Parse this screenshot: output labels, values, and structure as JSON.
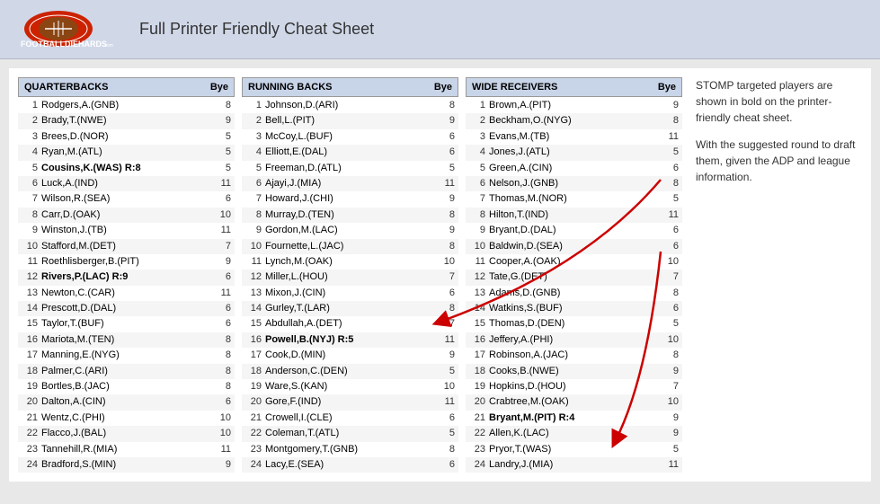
{
  "header": {
    "title": "Full Printer Friendly Cheat Sheet"
  },
  "sidebar": {
    "text1": "STOMP targeted players are shown in bold on the printer-friendly cheat sheet.",
    "text2": "With the suggested round to draft them, given the ADP and league information."
  },
  "columns": {
    "quarterbacks": {
      "header": "QUARTERBACKS",
      "bye_label": "Bye",
      "players": [
        {
          "num": 1,
          "name": "Rodgers,A.(GNB)",
          "bye": 8,
          "bold": false
        },
        {
          "num": 2,
          "name": "Brady,T.(NWE)",
          "bye": 9,
          "bold": false
        },
        {
          "num": 3,
          "name": "Brees,D.(NOR)",
          "bye": 5,
          "bold": false
        },
        {
          "num": 4,
          "name": "Ryan,M.(ATL)",
          "bye": 5,
          "bold": false
        },
        {
          "num": 5,
          "name": "Cousins,K.(WAS) R:8",
          "bye": 5,
          "bold": true
        },
        {
          "num": 6,
          "name": "Luck,A.(IND)",
          "bye": 11,
          "bold": false
        },
        {
          "num": 7,
          "name": "Wilson,R.(SEA)",
          "bye": 6,
          "bold": false
        },
        {
          "num": 8,
          "name": "Carr,D.(OAK)",
          "bye": 10,
          "bold": false
        },
        {
          "num": 9,
          "name": "Winston,J.(TB)",
          "bye": 11,
          "bold": false
        },
        {
          "num": 10,
          "name": "Stafford,M.(DET)",
          "bye": 7,
          "bold": false
        },
        {
          "num": 11,
          "name": "Roethlisberger,B.(PIT)",
          "bye": 9,
          "bold": false
        },
        {
          "num": 12,
          "name": "Rivers,P.(LAC) R:9",
          "bye": 6,
          "bold": true
        },
        {
          "num": 13,
          "name": "Newton,C.(CAR)",
          "bye": 11,
          "bold": false
        },
        {
          "num": 14,
          "name": "Prescott,D.(DAL)",
          "bye": 6,
          "bold": false
        },
        {
          "num": 15,
          "name": "Taylor,T.(BUF)",
          "bye": 6,
          "bold": false
        },
        {
          "num": 16,
          "name": "Mariota,M.(TEN)",
          "bye": 8,
          "bold": false
        },
        {
          "num": 17,
          "name": "Manning,E.(NYG)",
          "bye": 8,
          "bold": false
        },
        {
          "num": 18,
          "name": "Palmer,C.(ARI)",
          "bye": 8,
          "bold": false
        },
        {
          "num": 19,
          "name": "Bortles,B.(JAC)",
          "bye": 8,
          "bold": false
        },
        {
          "num": 20,
          "name": "Dalton,A.(CIN)",
          "bye": 6,
          "bold": false
        },
        {
          "num": 21,
          "name": "Wentz,C.(PHI)",
          "bye": 10,
          "bold": false
        },
        {
          "num": 22,
          "name": "Flacco,J.(BAL)",
          "bye": 10,
          "bold": false
        },
        {
          "num": 23,
          "name": "Tannehill,R.(MIA)",
          "bye": 11,
          "bold": false
        },
        {
          "num": 24,
          "name": "Bradford,S.(MIN)",
          "bye": 9,
          "bold": false
        }
      ]
    },
    "runningbacks": {
      "header": "RUNNING BACKS",
      "bye_label": "Bye",
      "players": [
        {
          "num": 1,
          "name": "Johnson,D.(ARI)",
          "bye": 8,
          "bold": false
        },
        {
          "num": 2,
          "name": "Bell,L.(PIT)",
          "bye": 9,
          "bold": false
        },
        {
          "num": 3,
          "name": "McCoy,L.(BUF)",
          "bye": 6,
          "bold": false
        },
        {
          "num": 4,
          "name": "Elliott,E.(DAL)",
          "bye": 6,
          "bold": false
        },
        {
          "num": 5,
          "name": "Freeman,D.(ATL)",
          "bye": 5,
          "bold": false
        },
        {
          "num": 6,
          "name": "Ajayi,J.(MIA)",
          "bye": 11,
          "bold": false
        },
        {
          "num": 7,
          "name": "Howard,J.(CHI)",
          "bye": 9,
          "bold": false
        },
        {
          "num": 8,
          "name": "Murray,D.(TEN)",
          "bye": 8,
          "bold": false
        },
        {
          "num": 9,
          "name": "Gordon,M.(LAC)",
          "bye": 9,
          "bold": false
        },
        {
          "num": 10,
          "name": "Fournette,L.(JAC)",
          "bye": 8,
          "bold": false
        },
        {
          "num": 11,
          "name": "Lynch,M.(OAK)",
          "bye": 10,
          "bold": false
        },
        {
          "num": 12,
          "name": "Miller,L.(HOU)",
          "bye": 7,
          "bold": false
        },
        {
          "num": 13,
          "name": "Mixon,J.(CIN)",
          "bye": 6,
          "bold": false
        },
        {
          "num": 14,
          "name": "Gurley,T.(LAR)",
          "bye": 8,
          "bold": false
        },
        {
          "num": 15,
          "name": "Abdullah,A.(DET)",
          "bye": 7,
          "bold": false
        },
        {
          "num": 16,
          "name": "Powell,B.(NYJ) R:5",
          "bye": 11,
          "bold": true
        },
        {
          "num": 17,
          "name": "Cook,D.(MIN)",
          "bye": 9,
          "bold": false
        },
        {
          "num": 18,
          "name": "Anderson,C.(DEN)",
          "bye": 5,
          "bold": false
        },
        {
          "num": 19,
          "name": "Ware,S.(KAN)",
          "bye": 10,
          "bold": false
        },
        {
          "num": 20,
          "name": "Gore,F.(IND)",
          "bye": 11,
          "bold": false
        },
        {
          "num": 21,
          "name": "Crowell,I.(CLE)",
          "bye": 6,
          "bold": false
        },
        {
          "num": 22,
          "name": "Coleman,T.(ATL)",
          "bye": 5,
          "bold": false
        },
        {
          "num": 23,
          "name": "Montgomery,T.(GNB)",
          "bye": 8,
          "bold": false
        },
        {
          "num": 24,
          "name": "Lacy,E.(SEA)",
          "bye": 6,
          "bold": false
        }
      ]
    },
    "widereceivers": {
      "header": "WIDE RECEIVERS",
      "bye_label": "Bye",
      "players": [
        {
          "num": 1,
          "name": "Brown,A.(PIT)",
          "bye": 9,
          "bold": false
        },
        {
          "num": 2,
          "name": "Beckham,O.(NYG)",
          "bye": 8,
          "bold": false
        },
        {
          "num": 3,
          "name": "Evans,M.(TB)",
          "bye": 11,
          "bold": false
        },
        {
          "num": 4,
          "name": "Jones,J.(ATL)",
          "bye": 5,
          "bold": false
        },
        {
          "num": 5,
          "name": "Green,A.(CIN)",
          "bye": 6,
          "bold": false
        },
        {
          "num": 6,
          "name": "Nelson,J.(GNB)",
          "bye": 8,
          "bold": false
        },
        {
          "num": 7,
          "name": "Thomas,M.(NOR)",
          "bye": 5,
          "bold": false
        },
        {
          "num": 8,
          "name": "Hilton,T.(IND)",
          "bye": 11,
          "bold": false
        },
        {
          "num": 9,
          "name": "Bryant,D.(DAL)",
          "bye": 6,
          "bold": false
        },
        {
          "num": 10,
          "name": "Baldwin,D.(SEA)",
          "bye": 6,
          "bold": false
        },
        {
          "num": 11,
          "name": "Cooper,A.(OAK)",
          "bye": 10,
          "bold": false
        },
        {
          "num": 12,
          "name": "Tate,G.(DET)",
          "bye": 7,
          "bold": false
        },
        {
          "num": 13,
          "name": "Adams,D.(GNB)",
          "bye": 8,
          "bold": false
        },
        {
          "num": 14,
          "name": "Watkins,S.(BUF)",
          "bye": 6,
          "bold": false
        },
        {
          "num": 15,
          "name": "Thomas,D.(DEN)",
          "bye": 5,
          "bold": false
        },
        {
          "num": 16,
          "name": "Jeffery,A.(PHI)",
          "bye": 10,
          "bold": false
        },
        {
          "num": 17,
          "name": "Robinson,A.(JAC)",
          "bye": 8,
          "bold": false
        },
        {
          "num": 18,
          "name": "Cooks,B.(NWE)",
          "bye": 9,
          "bold": false
        },
        {
          "num": 19,
          "name": "Hopkins,D.(HOU)",
          "bye": 7,
          "bold": false
        },
        {
          "num": 20,
          "name": "Crabtree,M.(OAK)",
          "bye": 10,
          "bold": false
        },
        {
          "num": 21,
          "name": "Bryant,M.(PIT) R:4",
          "bye": 9,
          "bold": true
        },
        {
          "num": 22,
          "name": "Allen,K.(LAC)",
          "bye": 9,
          "bold": false
        },
        {
          "num": 23,
          "name": "Pryor,T.(WAS)",
          "bye": 5,
          "bold": false
        },
        {
          "num": 24,
          "name": "Landry,J.(MIA)",
          "bye": 11,
          "bold": false
        }
      ]
    }
  }
}
